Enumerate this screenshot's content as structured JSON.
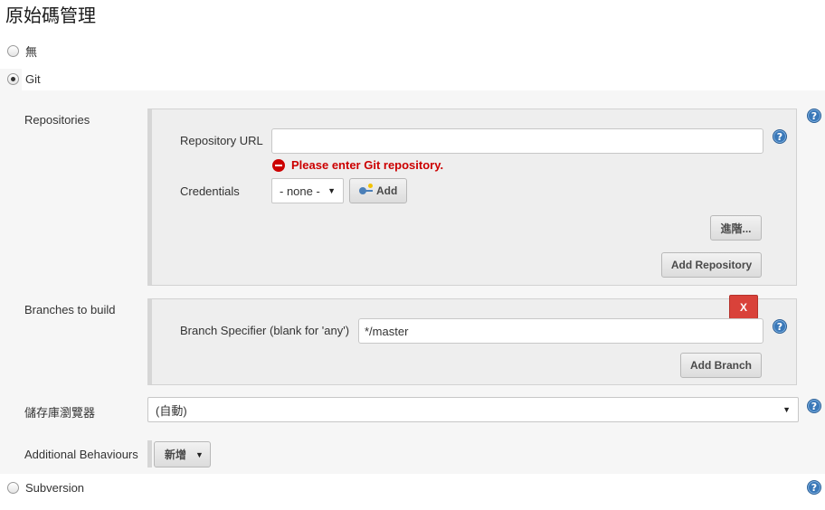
{
  "page": {
    "title": "原始碼管理"
  },
  "scm_options": {
    "none_label": "無",
    "git_label": "Git",
    "subversion_label": "Subversion",
    "selected": "Git"
  },
  "repositories": {
    "section_label": "Repositories",
    "url_label": "Repository URL",
    "url_value": "",
    "url_error": "Please enter Git repository.",
    "credentials_label": "Credentials",
    "credentials_selected": "- none -",
    "add_credentials_label": "Add",
    "advanced_button": "進階...",
    "add_repository_button": "Add Repository"
  },
  "branches": {
    "section_label": "Branches to build",
    "delete_button": "X",
    "specifier_label": "Branch Specifier (blank for 'any')",
    "specifier_value": "*/master",
    "add_branch_button": "Add Branch"
  },
  "repo_browser": {
    "label": "儲存庫瀏覽器",
    "selected": "(自動)"
  },
  "additional_behaviours": {
    "label": "Additional Behaviours",
    "add_button": "新增"
  },
  "help": {
    "glyph": "?"
  },
  "colors": {
    "error": "#cc0000",
    "help_blue": "#3a78b8",
    "delete_red": "#d9423a",
    "section_bg": "#f6f6f6",
    "nested_bg": "#eeeeee"
  }
}
